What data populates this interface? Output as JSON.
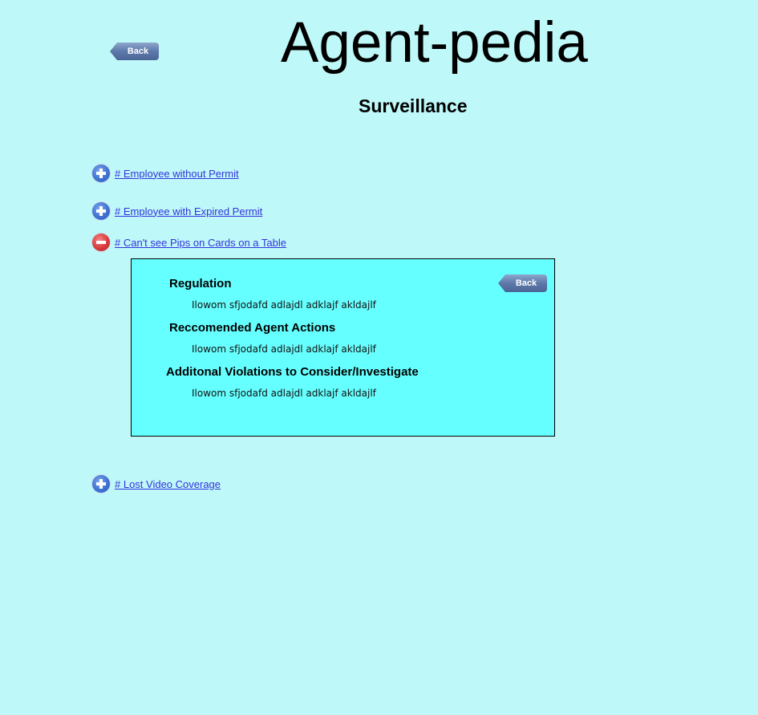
{
  "header": {
    "title": "Agent-pedia",
    "subtitle": "Surveillance",
    "back_label": "Back"
  },
  "topics": [
    {
      "label": "# Employee without Permit",
      "state": "collapsed",
      "icon": "expand-plus-icon"
    },
    {
      "label": "# Employee with Expired Permit",
      "state": "collapsed",
      "icon": "expand-plus-icon"
    },
    {
      "label": "# Can't see Pips on Cards on a Table",
      "state": "expanded",
      "icon": "collapse-minus-icon"
    },
    {
      "label": "# Lost Video Coverage",
      "state": "collapsed",
      "icon": "expand-plus-icon"
    }
  ],
  "detail": {
    "back_label": "Back",
    "sections": [
      {
        "heading": "Regulation",
        "body": "Ilowom sfjodafd adlajdl adklajf  akldajlf"
      },
      {
        "heading": "Reccomended Agent Actions",
        "body": "Ilowom sfjodafd adlajdl adklajf  akldajlf"
      },
      {
        "heading": "Additonal Violations to Consider/Investigate",
        "body": "Ilowom sfjodafd adlajdl adklajf  akldajlf"
      }
    ]
  },
  "colors": {
    "page_background": "#bff8f8",
    "panel_background": "#66ffff",
    "link": "#3333dd",
    "back_button": "#5d78aa"
  }
}
